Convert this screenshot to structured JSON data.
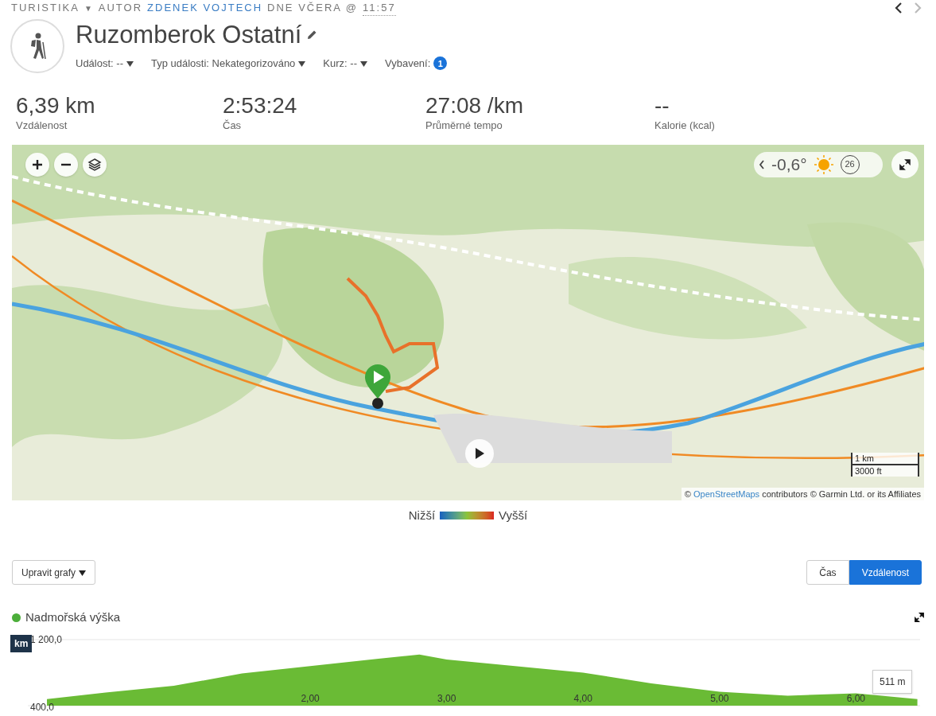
{
  "breadcrumb": {
    "category": "TURISTIKA",
    "caret": "▼",
    "author_prefix": "AUTOR",
    "author": "ZDENEK VOJTECH",
    "date": "DNE VČERA @",
    "time": "11:57"
  },
  "title": "Ruzomberok Ostatní",
  "meta": [
    {
      "label": "Událost: --",
      "kind": "dropdown"
    },
    {
      "label": "Typ události: Nekategorizováno",
      "kind": "dropdown"
    },
    {
      "label": "Kurz: --",
      "kind": "dropdown"
    },
    {
      "label": "Vybavení:",
      "kind": "count",
      "count": "1"
    }
  ],
  "stats": [
    {
      "value": "6,39 km",
      "label": "Vzdálenost"
    },
    {
      "value": "2:53:24",
      "label": "Čas"
    },
    {
      "value": "27:08 /km",
      "label": "Průměrné tempo"
    },
    {
      "value": "--",
      "label": "Kalorie (kcal)"
    }
  ],
  "map": {
    "weather": {
      "temperature": "-0,6°",
      "wind": "26"
    },
    "scale": [
      "1 km",
      "3000 ft"
    ],
    "attribution": {
      "prefix": "©",
      "link": "OpenStreetMaps",
      "rest": "contributors © Garmin Ltd. or its Affiliates"
    }
  },
  "legend": {
    "low": "Nižší",
    "high": "Vyšší"
  },
  "edit_charts": "Upravit grafy",
  "axis_toggle": [
    {
      "label": "Čas",
      "selected": false
    },
    {
      "label": "Vzdálenost",
      "selected": true
    }
  ],
  "elevation": {
    "unit_badge": "km",
    "tooltip": "511 m",
    "chart_data": {
      "type": "area",
      "x": [
        0.07,
        0.5,
        1.0,
        1.5,
        2.0,
        2.5,
        2.8,
        3.0,
        3.5,
        4.0,
        4.5,
        5.0,
        5.5,
        6.0,
        6.45
      ],
      "series": [
        {
          "name": "Nadmořská výška",
          "color": "#6abb35",
          "values": [
            480,
            560,
            640,
            790,
            880,
            970,
            1020,
            960,
            880,
            800,
            670,
            570,
            520,
            550,
            480
          ]
        }
      ],
      "xticks": [
        {
          "value": 2,
          "label": "2,00"
        },
        {
          "value": 3,
          "label": "3,00"
        },
        {
          "value": 4,
          "label": "4,00"
        },
        {
          "value": 5,
          "label": "5,00"
        },
        {
          "value": 6,
          "label": "6,00"
        }
      ],
      "yticks": [
        {
          "value": 400,
          "label": "400,0"
        },
        {
          "value": 1200,
          "label": "1 200,0"
        }
      ],
      "xlim": [
        -0.07,
        6.47
      ],
      "ylim": [
        400,
        1200
      ]
    }
  }
}
